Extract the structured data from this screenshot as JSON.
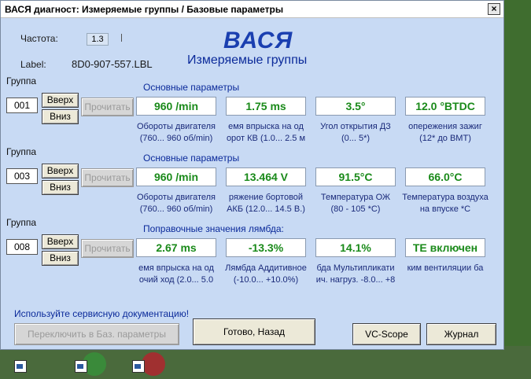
{
  "window": {
    "title": "ВАСЯ диагност: Измеряемые группы / Базовые параметры",
    "close_glyph": "×"
  },
  "header": {
    "freq_label": "Частота:",
    "freq_value": "1.3",
    "label_label": "Label:",
    "label_value": "8D0-907-557.LBL",
    "app_name": "ВАСЯ",
    "app_subtitle": "Измеряемые группы"
  },
  "groups": [
    {
      "group_label": "Группа",
      "group_number": "001",
      "up_label": "Вверх",
      "down_label": "Вниз",
      "read_label": "Прочитать",
      "section": "Основные параметры",
      "values": [
        "960 /min",
        "1.75 ms",
        "3.5°",
        "12.0 °BTDC"
      ],
      "desc_line1": [
        "Обороты двигателя",
        "емя впрыска на од",
        "Угол открытия ДЗ",
        "опережения зажиг"
      ],
      "desc_line2": [
        "(760... 960 об/min)",
        "орот КВ (1.0... 2.5 м",
        "(0... 5*)",
        "(12* до ВМТ)"
      ]
    },
    {
      "group_label": "Группа",
      "group_number": "003",
      "up_label": "Вверх",
      "down_label": "Вниз",
      "read_label": "Прочитать",
      "section": "Основные параметры",
      "values": [
        "960 /min",
        "13.464 V",
        "91.5°C",
        "66.0°C"
      ],
      "desc_line1": [
        "Обороты двигателя",
        "ряжение бортовой",
        "Температура ОЖ",
        "Температура воздуха"
      ],
      "desc_line2": [
        "(760... 960 об/min)",
        "АКБ (12.0... 14.5 В.)",
        "(80 - 105 *С)",
        "на впуске *С"
      ]
    },
    {
      "group_label": "Группа",
      "group_number": "008",
      "up_label": "Вверх",
      "down_label": "Вниз",
      "read_label": "Прочитать",
      "section": "Поправочные значения лямбда:",
      "values": [
        "2.67 ms",
        "-13.3%",
        "14.1%",
        "TE включен"
      ],
      "desc_line1": [
        "емя впрыска на од",
        "Лямбда Аддитивное",
        "бда Мультипликати",
        "ким вентиляции ба"
      ],
      "desc_line2": [
        "очий ход (2.0... 5.0",
        "(-10.0... +10.0%)",
        "ич. нагруз. -8.0... +8",
        ""
      ]
    }
  ],
  "footer": {
    "notice": "Используйте сервисную документацию!",
    "switch_label": "Переключить в Баз. параметры",
    "done_label": "Готово, Назад",
    "vcscope_label": "VC-Scope",
    "journal_label": "Журнал"
  }
}
